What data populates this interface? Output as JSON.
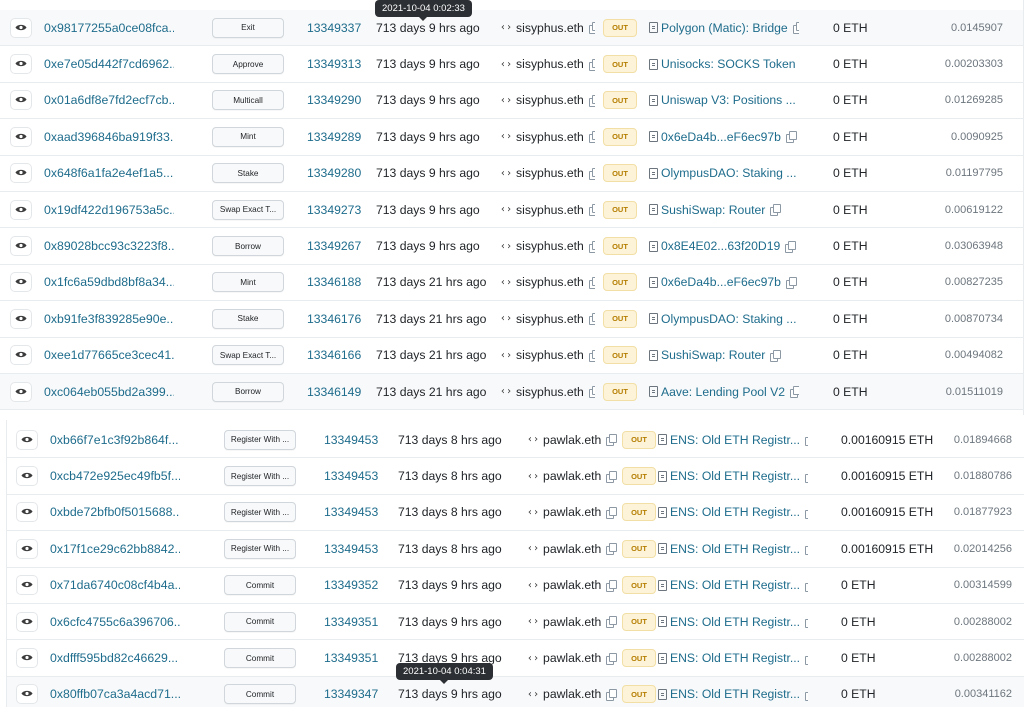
{
  "table_a": {
    "rows": [
      {
        "hash": "0x98177255a0ce08fca...",
        "method": "Exit",
        "block": "13349337",
        "age": "713 days 9 hrs ago",
        "from": "sisyphus.eth",
        "direction": "OUT",
        "to": "Polygon (Matic): Bridge",
        "value": "0 ETH",
        "fee": "0.0145907"
      },
      {
        "hash": "0xe7e05d442f7cd6962...",
        "method": "Approve",
        "block": "13349313",
        "age": "713 days 9 hrs ago",
        "from": "sisyphus.eth",
        "direction": "OUT",
        "to": "Unisocks: SOCKS Token",
        "value": "0 ETH",
        "fee": "0.00203303"
      },
      {
        "hash": "0x01a6df8e7fd2ecf7cb...",
        "method": "Multicall",
        "block": "13349290",
        "age": "713 days 9 hrs ago",
        "from": "sisyphus.eth",
        "direction": "OUT",
        "to": "Uniswap V3: Positions ...",
        "value": "0 ETH",
        "fee": "0.01269285"
      },
      {
        "hash": "0xaad396846ba919f33...",
        "method": "Mint",
        "block": "13349289",
        "age": "713 days 9 hrs ago",
        "from": "sisyphus.eth",
        "direction": "OUT",
        "to": "0x6eDa4b...eF6ec97b",
        "value": "0 ETH",
        "fee": "0.0090925"
      },
      {
        "hash": "0x648f6a1fa2e4ef1a5...",
        "method": "Stake",
        "block": "13349280",
        "age": "713 days 9 hrs ago",
        "from": "sisyphus.eth",
        "direction": "OUT",
        "to": "OlympusDAO: Staking ...",
        "value": "0 ETH",
        "fee": "0.01197795"
      },
      {
        "hash": "0x19df422d196753a5c...",
        "method": "Swap Exact T...",
        "block": "13349273",
        "age": "713 days 9 hrs ago",
        "from": "sisyphus.eth",
        "direction": "OUT",
        "to": "SushiSwap: Router",
        "value": "0 ETH",
        "fee": "0.00619122"
      },
      {
        "hash": "0x89028bcc93c3223f8...",
        "method": "Borrow",
        "block": "13349267",
        "age": "713 days 9 hrs ago",
        "from": "sisyphus.eth",
        "direction": "OUT",
        "to": "0x8E4E02...63f20D19",
        "value": "0 ETH",
        "fee": "0.03063948"
      },
      {
        "hash": "0x1fc6a59dbd8bf8a34...",
        "method": "Mint",
        "block": "13346188",
        "age": "713 days 21 hrs ago",
        "from": "sisyphus.eth",
        "direction": "OUT",
        "to": "0x6eDa4b...eF6ec97b",
        "value": "0 ETH",
        "fee": "0.00827235"
      },
      {
        "hash": "0xb91fe3f839285e90e...",
        "method": "Stake",
        "block": "13346176",
        "age": "713 days 21 hrs ago",
        "from": "sisyphus.eth",
        "direction": "OUT",
        "to": "OlympusDAO: Staking ...",
        "value": "0 ETH",
        "fee": "0.00870734"
      },
      {
        "hash": "0xee1d77665ce3cec41...",
        "method": "Swap Exact T...",
        "block": "13346166",
        "age": "713 days 21 hrs ago",
        "from": "sisyphus.eth",
        "direction": "OUT",
        "to": "SushiSwap: Router",
        "value": "0 ETH",
        "fee": "0.00494082"
      },
      {
        "hash": "0xc064eb055bd2a399...",
        "method": "Borrow",
        "block": "13346149",
        "age": "713 days 21 hrs ago",
        "from": "sisyphus.eth",
        "direction": "OUT",
        "to": "Aave: Lending Pool V2",
        "value": "0 ETH",
        "fee": "0.01511019"
      }
    ],
    "tooltip": "2021-10-04 0:02:33"
  },
  "table_b": {
    "rows": [
      {
        "hash": "0xb66f7e1c3f92b864f...",
        "method": "Register With ...",
        "block": "13349453",
        "age": "713 days 8 hrs ago",
        "from": "pawlak.eth",
        "direction": "OUT",
        "to": "ENS: Old ETH Registr...",
        "value": "0.00160915 ETH",
        "fee": "0.01894668"
      },
      {
        "hash": "0xcb472e925ec49fb5f...",
        "method": "Register With ...",
        "block": "13349453",
        "age": "713 days 8 hrs ago",
        "from": "pawlak.eth",
        "direction": "OUT",
        "to": "ENS: Old ETH Registr...",
        "value": "0.00160915 ETH",
        "fee": "0.01880786"
      },
      {
        "hash": "0xbde72bfb0f5015688...",
        "method": "Register With ...",
        "block": "13349453",
        "age": "713 days 8 hrs ago",
        "from": "pawlak.eth",
        "direction": "OUT",
        "to": "ENS: Old ETH Registr...",
        "value": "0.00160915 ETH",
        "fee": "0.01877923"
      },
      {
        "hash": "0x17f1ce29c62bb8842...",
        "method": "Register With ...",
        "block": "13349453",
        "age": "713 days 8 hrs ago",
        "from": "pawlak.eth",
        "direction": "OUT",
        "to": "ENS: Old ETH Registr...",
        "value": "0.00160915 ETH",
        "fee": "0.02014256"
      },
      {
        "hash": "0x71da6740c08cf4b4a...",
        "method": "Commit",
        "block": "13349352",
        "age": "713 days 9 hrs ago",
        "from": "pawlak.eth",
        "direction": "OUT",
        "to": "ENS: Old ETH Registr...",
        "value": "0 ETH",
        "fee": "0.00314599"
      },
      {
        "hash": "0x6cfc4755c6a396706...",
        "method": "Commit",
        "block": "13349351",
        "age": "713 days 9 hrs ago",
        "from": "pawlak.eth",
        "direction": "OUT",
        "to": "ENS: Old ETH Registr...",
        "value": "0 ETH",
        "fee": "0.00288002"
      },
      {
        "hash": "0xdfff595bd82c46629...",
        "method": "Commit",
        "block": "13349351",
        "age": "713 days 9 hrs ago",
        "from": "pawlak.eth",
        "direction": "OUT",
        "to": "ENS: Old ETH Registr...",
        "value": "0 ETH",
        "fee": "0.00288002"
      },
      {
        "hash": "0x80ffb07ca3a4acd71...",
        "method": "Commit",
        "block": "13349347",
        "age": "713 days 9 hrs ago",
        "from": "pawlak.eth",
        "direction": "OUT",
        "to": "ENS: Old ETH Registr...",
        "value": "0 ETH",
        "fee": "0.00341162"
      }
    ],
    "tooltip": "2021-10-04 0:04:31"
  }
}
